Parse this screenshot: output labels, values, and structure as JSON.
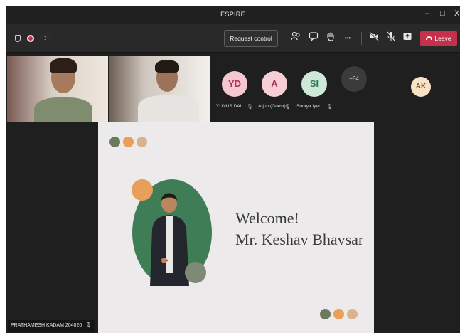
{
  "window": {
    "title": "ESPIRE",
    "minimize_glyph": "–",
    "maximize_glyph": "□",
    "close_glyph": "X"
  },
  "toolbar": {
    "timer": "--:--",
    "request_control_label": "Request control",
    "more_glyph": "•••",
    "leave_label": "Leave",
    "icons": [
      "people-icon",
      "chat-icon",
      "raise-hand-icon",
      "more-icon",
      "camera-off-icon",
      "mic-off-icon",
      "share-icon",
      "phone-icon"
    ]
  },
  "participants": {
    "avatars": [
      {
        "initials": "YD",
        "name": "YUNUS DAL...",
        "color": "#f5c7d3",
        "text_color": "#b0334f"
      },
      {
        "initials": "A",
        "name": "Arjun (Guest)",
        "color": "#f6cfd6",
        "text_color": "#b0334f"
      },
      {
        "initials": "SI",
        "name": "Soorya Iyer ...",
        "color": "#cfe9d8",
        "text_color": "#2e7d4f"
      },
      {
        "initials": "+84",
        "name": "",
        "color": "#3b3b3b",
        "text_color": "#d8d8d8"
      }
    ],
    "side_avatar": {
      "initials": "AK",
      "color": "#f7e2c6",
      "text_color": "#7a5a2a"
    }
  },
  "slide": {
    "welcome_line1": "Welcome!",
    "welcome_line2": "Mr. Keshav Bhavsar",
    "dot_colors": [
      "#6b7a5c",
      "#e89f5a",
      "#d9b28f"
    ]
  },
  "presenter_label": "PRATHAMESH KADAM 204020"
}
